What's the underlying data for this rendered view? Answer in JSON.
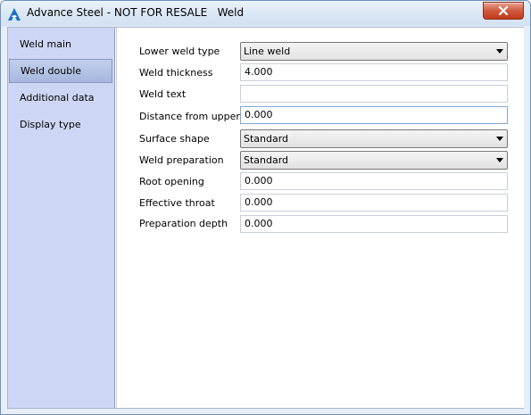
{
  "window": {
    "title": "Advance Steel - NOT FOR RESALE   Weld",
    "icon": "advance-steel-logo-icon",
    "close_icon": "close-icon"
  },
  "sidebar": {
    "items": [
      {
        "label": "Weld main"
      },
      {
        "label": "Weld double",
        "selected": true
      },
      {
        "label": "Additional data"
      },
      {
        "label": "Display type"
      }
    ]
  },
  "form": {
    "lower_weld_type": {
      "label": "Lower weld type",
      "value": "Line weld"
    },
    "weld_thickness": {
      "label": "Weld thickness",
      "value": "4.000"
    },
    "weld_text": {
      "label": "Weld text",
      "value": ""
    },
    "distance_from_upper": {
      "label": "Distance from upper",
      "value": "0.000"
    },
    "surface_shape": {
      "label": "Surface shape",
      "value": "Standard"
    },
    "weld_preparation": {
      "label": "Weld preparation",
      "value": "Standard"
    },
    "root_opening": {
      "label": "Root opening",
      "value": "0.000"
    },
    "effective_throat": {
      "label": "Effective throat",
      "value": "0.000"
    },
    "preparation_depth": {
      "label": "Preparation depth",
      "value": "0.000"
    }
  }
}
